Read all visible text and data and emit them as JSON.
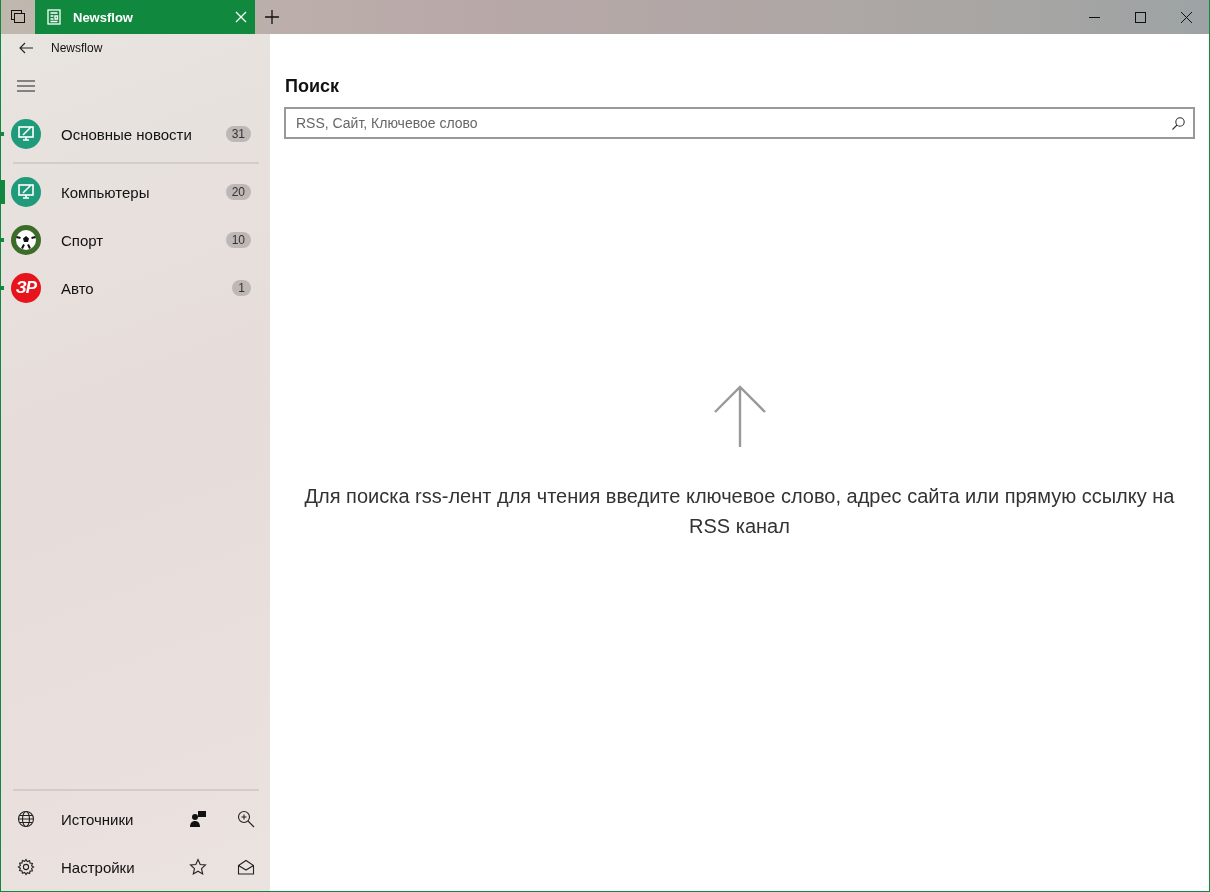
{
  "tab": {
    "title": "Newsflow"
  },
  "app_bar": {
    "title": "Newsflow"
  },
  "feeds": [
    {
      "name": "Основные новости",
      "count": "31",
      "kind": "image",
      "selected": false
    },
    {
      "name": "Компьютеры",
      "count": "20",
      "kind": "image",
      "selected": true
    },
    {
      "name": "Спорт",
      "count": "10",
      "kind": "image",
      "selected": false
    },
    {
      "name": "Авто",
      "count": "1",
      "kind": "logo",
      "logo_text": "ЗР",
      "selected": false
    }
  ],
  "bottom_items": [
    {
      "label": "Источники"
    },
    {
      "label": "Настройки"
    }
  ],
  "search": {
    "title": "Поиск",
    "placeholder": "RSS, Сайт, Ключевое слово"
  },
  "hint": "Для поиска rss-лент для чтения введите ключевое слово, адрес сайта или прямую ссылку на RSS канал"
}
